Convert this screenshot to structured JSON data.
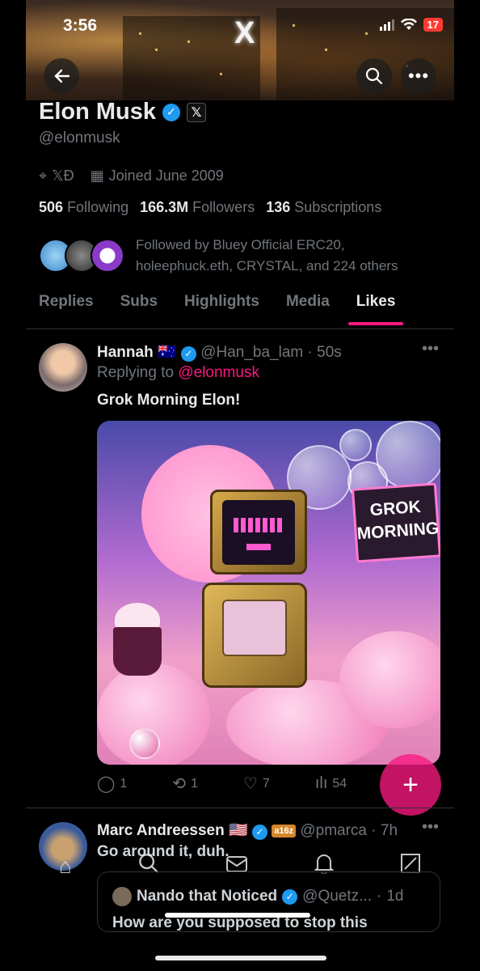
{
  "status": {
    "time": "3:56",
    "battery": "17"
  },
  "banner": {
    "logo": "X"
  },
  "profile": {
    "name": "Elon Musk",
    "x_badge": "𝕏",
    "handle": "@elonmusk",
    "location": "𝕏Ð",
    "joined": "Joined June 2009",
    "following_count": "506",
    "following_label": "Following",
    "followers_count": "166.3M",
    "followers_label": "Followers",
    "subscriptions_count": "136",
    "subscriptions_label": "Subscriptions",
    "followed_by": "Followed by Bluey Official ERC20, holeephuck.eth, CRYSTAL, and 224 others"
  },
  "tabs": [
    {
      "label": "Replies"
    },
    {
      "label": "Subs"
    },
    {
      "label": "Highlights"
    },
    {
      "label": "Media"
    },
    {
      "label": "Likes",
      "active": true
    }
  ],
  "posts": [
    {
      "author": "Hannah",
      "flag": "🇦🇺",
      "handle": "@Han_ba_lam",
      "time": "50s",
      "replying_prefix": "Replying to",
      "replying_handle": "@elonmusk",
      "text": "Grok Morning Elon!",
      "image_sign": "GROK MORNING",
      "replies": "1",
      "reposts": "1",
      "likes": "7",
      "views": "54"
    },
    {
      "author": "Marc Andreessen",
      "flag": "🇺🇸",
      "badge": "a16z",
      "handle": "@pmarca",
      "time": "7h",
      "text": "Go around it, duh.",
      "quote": {
        "author": "Nando that Noticed",
        "handle": "@Quetz...",
        "time": "1d",
        "text": "How are you supposed to stop this"
      }
    }
  ],
  "colors": {
    "accent": "#f91880",
    "verified": "#1d9bf0",
    "muted": "#71767b"
  }
}
